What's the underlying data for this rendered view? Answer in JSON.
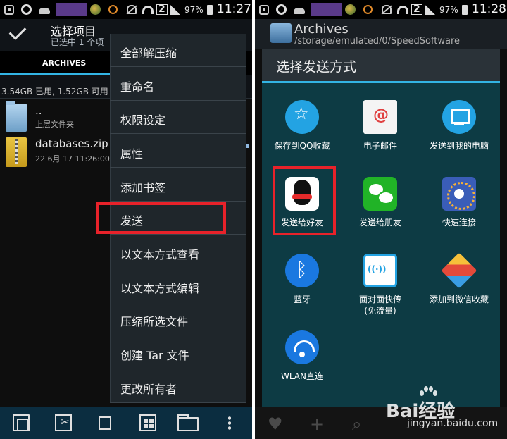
{
  "left": {
    "status": {
      "time": "11:27",
      "battery": "97%",
      "sim": "2"
    },
    "action_bar": {
      "title": "选择项目",
      "subtitle": "已选中 1 个项"
    },
    "tab": {
      "label": "ARCHIVES"
    },
    "storage_text": "3.54GB 已用, 1.52GB 可用",
    "files": [
      {
        "name": "..",
        "sub": "上层文件夹"
      },
      {
        "name": "databases.zip",
        "sub": "22 6月 17 11:26:00"
      }
    ],
    "menu": [
      "全部解压缩",
      "重命名",
      "权限设定",
      "属性",
      "添加书签",
      "发送",
      "以文本方式查看",
      "以文本方式编辑",
      "压缩所选文件",
      "创建 Tar 文件",
      "更改所有者"
    ]
  },
  "right": {
    "status": {
      "time": "11:28",
      "battery": "97%",
      "sim": "2"
    },
    "app_title": "Archives",
    "path": "/storage/emulated/0/SpeedSoftware",
    "dialog_title": "选择发送方式",
    "options": [
      {
        "label": "保存到QQ收藏",
        "icon": "qq-favorite-icon"
      },
      {
        "label": "电子邮件",
        "icon": "email-icon"
      },
      {
        "label": "发送到我的电脑",
        "icon": "send-to-pc-icon"
      },
      {
        "label": "发送给好友",
        "icon": "qq-icon"
      },
      {
        "label": "发送给朋友",
        "icon": "wechat-icon"
      },
      {
        "label": "快速连接",
        "icon": "quick-connect-icon"
      },
      {
        "label": "蓝牙",
        "icon": "bluetooth-icon"
      },
      {
        "label": "面对面快传",
        "label2": "(免流量)",
        "icon": "face-to-face-icon"
      },
      {
        "label": "添加到微信收藏",
        "icon": "wechat-favorite-icon"
      },
      {
        "label": "WLAN直连",
        "icon": "wlan-direct-icon"
      }
    ],
    "watermark": {
      "brand": "Bai经验",
      "url": "jingyan.baidu.com"
    }
  },
  "colors": {
    "accent": "#33b5e5",
    "highlight_box": "#e8222a",
    "dialog_bg": "#0d3b44",
    "menu_bg": "#1f262b"
  }
}
